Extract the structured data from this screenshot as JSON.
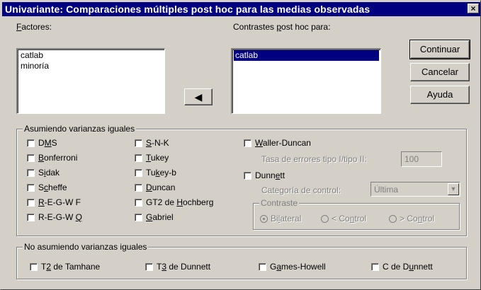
{
  "window": {
    "title": "Univariante: Comparaciones múltiples post hoc para las medias observadas",
    "close": "×"
  },
  "factores": {
    "label_pre": "",
    "label_key": "F",
    "label_post": "actores:",
    "items": [
      "catlab",
      "minoría"
    ]
  },
  "move_arrow": "◀",
  "contrastes": {
    "label_pre": "Contrastes ",
    "label_key": "p",
    "label_post": "ost hoc para:",
    "items": [
      "catlab"
    ]
  },
  "buttons": {
    "continuar": "Continuar",
    "cancelar": "Cancelar",
    "ayuda": "Ayuda"
  },
  "asumiendo": {
    "legend": "Asumiendo varianzas iguales",
    "col1": [
      {
        "pre": "D",
        "key": "M",
        "post": "S"
      },
      {
        "pre": "",
        "key": "B",
        "post": "onferroni"
      },
      {
        "pre": "S",
        "key": "i",
        "post": "dak"
      },
      {
        "pre": "S",
        "key": "c",
        "post": "heffe"
      },
      {
        "pre": "",
        "key": "R",
        "post": "-E-G-W F"
      },
      {
        "pre": "R-E-G-W ",
        "key": "Q",
        "post": ""
      }
    ],
    "col2": [
      {
        "pre": "",
        "key": "S",
        "post": "-N-K"
      },
      {
        "pre": "",
        "key": "T",
        "post": "ukey"
      },
      {
        "pre": "Tu",
        "key": "k",
        "post": "ey-b"
      },
      {
        "pre": "",
        "key": "D",
        "post": "uncan"
      },
      {
        "pre": "GT2 de ",
        "key": "H",
        "post": "ochberg"
      },
      {
        "pre": "",
        "key": "G",
        "post": "abriel"
      }
    ],
    "waller": {
      "pre": "",
      "key": "W",
      "post": "aller-Duncan"
    },
    "tasa_label": "Tasa de errores tipo I/tipo II:",
    "tasa_value": "100",
    "dunnett": {
      "pre": "Dunn",
      "key": "e",
      "post": "tt"
    },
    "categoria_label": "Categoría de control:",
    "categoria_value": "Última",
    "contraste_legend": "Contraste",
    "radios": [
      {
        "pre": "Bi",
        "key": "l",
        "post": "ateral",
        "selected": true
      },
      {
        "pre": "< Co",
        "key": "n",
        "post": "trol",
        "selected": false
      },
      {
        "pre": "> Co",
        "key": "n",
        "post": "trol",
        "selected": false
      }
    ]
  },
  "no_asumiendo": {
    "legend": "No asumiendo varianzas iguales",
    "items": [
      {
        "pre": "T",
        "key": "2",
        "post": " de Tamhane"
      },
      {
        "pre": "T",
        "key": "3",
        "post": " de Dunnett"
      },
      {
        "pre": "G",
        "key": "a",
        "post": "mes-Howell"
      },
      {
        "pre": "C de D",
        "key": "u",
        "post": "nnett"
      }
    ]
  }
}
